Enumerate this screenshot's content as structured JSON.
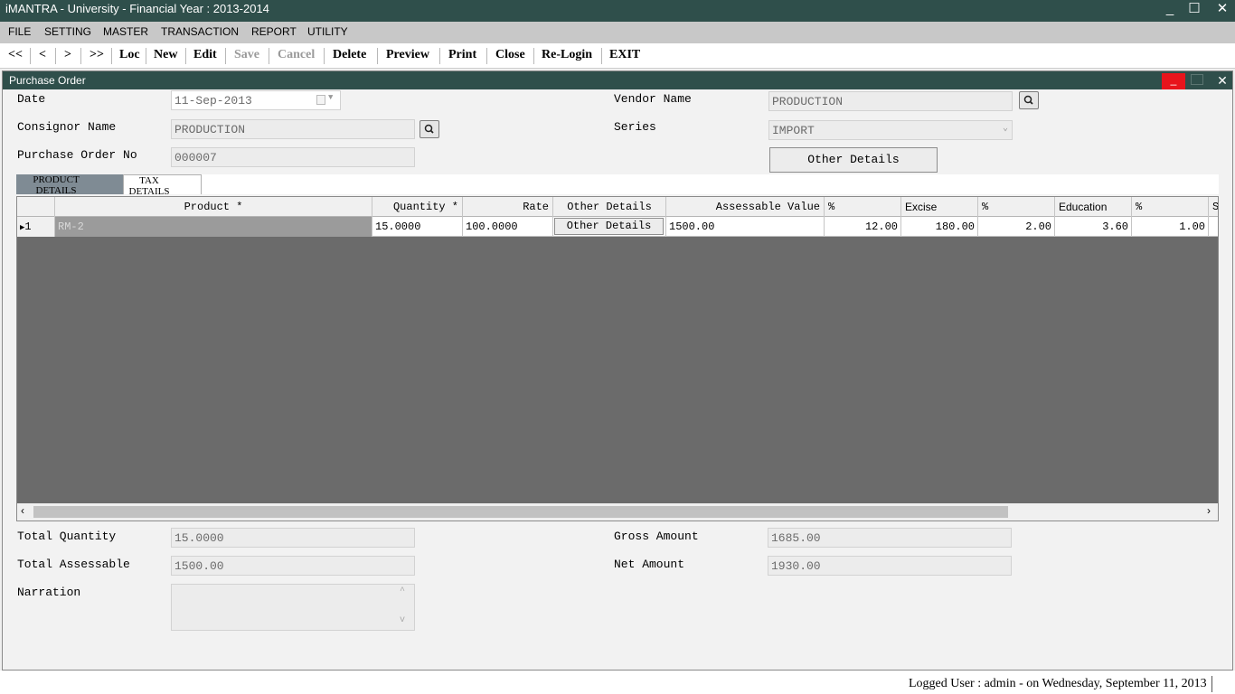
{
  "app": {
    "title": "iMANTRA - University - Financial Year : 2013-2014",
    "min": "_",
    "max": "☐",
    "close": "✕"
  },
  "menu": [
    "FILE",
    "SETTING",
    "MASTER",
    "TRANSACTION",
    "REPORT",
    "UTILITY"
  ],
  "toolbar": [
    "<<",
    "<",
    ">",
    ">>",
    "Loc",
    "New",
    "Edit",
    "Save",
    "Cancel",
    "Delete",
    "Preview",
    "Print",
    "Close",
    "Re-Login",
    "EXIT"
  ],
  "form": {
    "title": "Purchase Order",
    "min": "_",
    "close": "✕",
    "date_label": "Date",
    "date_value": "11-Sep-2013",
    "consignor_label": "Consignor Name",
    "consignor_value": "PRODUCTION",
    "po_label": "Purchase Order No",
    "po_value": "000007",
    "vendor_label": "Vendor Name",
    "vendor_value": "PRODUCTION",
    "series_label": "Series",
    "series_value": "IMPORT",
    "other_details_button": "Other Details"
  },
  "tabs": [
    "PRODUCT DETAILS",
    "TAX DETAILS"
  ],
  "grid": {
    "columns": [
      "",
      "Product *",
      "Quantity *",
      "Rate",
      "Other Details",
      "Assessable Value",
      "%",
      "Excise",
      "%",
      "Education",
      "%",
      "S"
    ],
    "row": {
      "num": "1",
      "product": "RM-2",
      "quantity": "15.0000",
      "rate": "100.0000",
      "other_details": "Other Details",
      "assessable": "1500.00",
      "pct1": "12.00",
      "excise": "180.00",
      "pct2": "2.00",
      "education": "3.60",
      "pct3": "1.00"
    }
  },
  "totals": {
    "total_quantity_label": "Total Quantity",
    "total_quantity_value": "15.0000",
    "total_assessable_label": "Total Assessable",
    "total_assessable_value": "1500.00",
    "narration_label": "Narration",
    "narration_value": "",
    "gross_amount_label": "Gross Amount",
    "gross_amount_value": "1685.00",
    "net_amount_label": "Net Amount",
    "net_amount_value": "1930.00"
  },
  "status": "Logged User : admin - on Wednesday, September 11, 2013"
}
